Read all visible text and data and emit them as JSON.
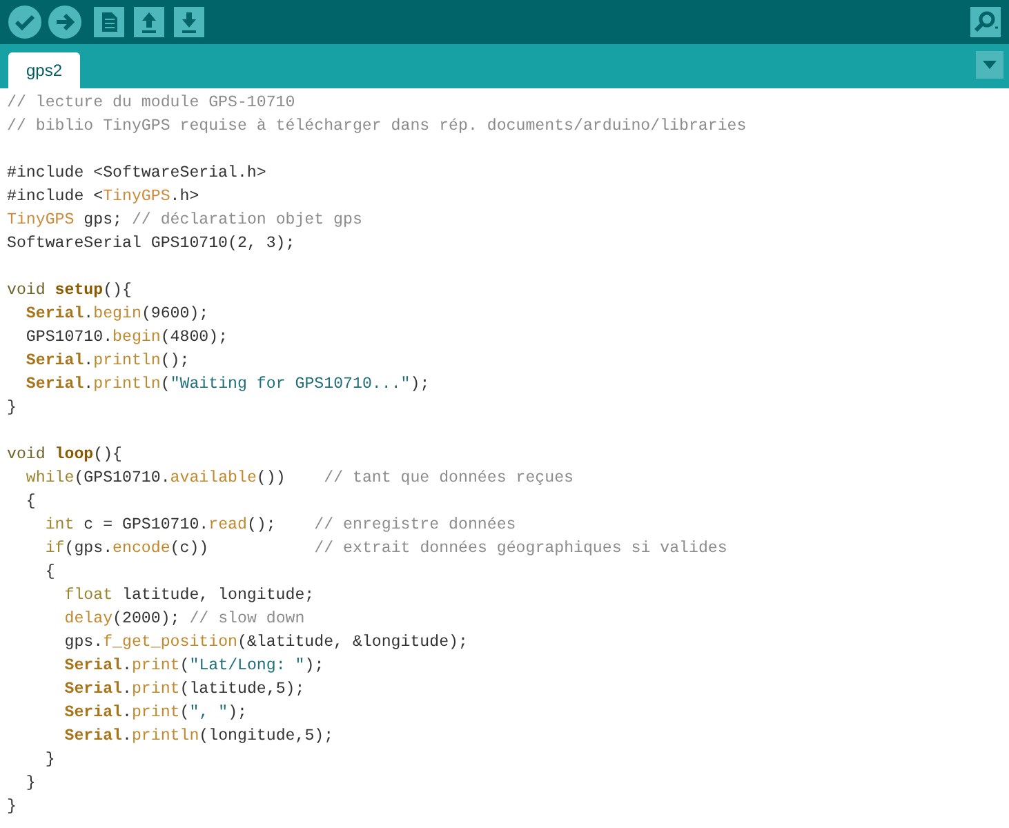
{
  "toolbar": {
    "buttons": [
      {
        "kind": "verify"
      },
      {
        "kind": "upload"
      },
      {
        "kind": "new"
      },
      {
        "kind": "open"
      },
      {
        "kind": "save"
      }
    ],
    "right_button": {
      "kind": "serial-monitor"
    }
  },
  "tabs": [
    {
      "label": "gps2",
      "selected": true
    }
  ],
  "code": {
    "lines": [
      {
        "tokens": [
          {
            "kind": "comment",
            "text": "// lecture du module GPS-10710"
          }
        ]
      },
      {
        "tokens": [
          {
            "kind": "comment",
            "text": "// biblio TinyGPS requise à télécharger dans rép. documents/arduino/libraries"
          }
        ]
      },
      {
        "space_before": true,
        "tokens": [
          {
            "kind": "plain",
            "text": "#include <SoftwareSerial.h>"
          }
        ]
      },
      {
        "tokens": [
          {
            "kind": "plain",
            "text": "#include <"
          },
          {
            "kind": "class",
            "text": "TinyGPS"
          },
          {
            "kind": "plain",
            "text": ".h>"
          }
        ]
      },
      {
        "tokens": [
          {
            "kind": "class",
            "text": "TinyGPS"
          },
          {
            "kind": "plain",
            "text": " gps; "
          },
          {
            "kind": "comment",
            "text": "// déclaration objet gps"
          }
        ]
      },
      {
        "tokens": [
          {
            "kind": "plain",
            "text": "SoftwareSerial GPS10710(2, 3);"
          }
        ]
      },
      {
        "space_before": true,
        "tokens": [
          {
            "kind": "type",
            "text": "void "
          },
          {
            "kind": "bold-keyword",
            "text": "setup"
          },
          {
            "kind": "plain",
            "text": "(){"
          }
        ]
      },
      {
        "tokens": [
          {
            "kind": "bold-class",
            "text": "  Serial"
          },
          {
            "kind": "plain",
            "text": "."
          },
          {
            "kind": "function",
            "text": "begin"
          },
          {
            "kind": "plain",
            "text": "(9600);"
          }
        ]
      },
      {
        "tokens": [
          {
            "kind": "plain",
            "text": "  GPS10710."
          },
          {
            "kind": "function",
            "text": "begin"
          },
          {
            "kind": "plain",
            "text": "(4800);"
          }
        ]
      },
      {
        "tokens": [
          {
            "kind": "bold-class",
            "text": "  Serial"
          },
          {
            "kind": "plain",
            "text": "."
          },
          {
            "kind": "function",
            "text": "println"
          },
          {
            "kind": "plain",
            "text": "();"
          }
        ]
      },
      {
        "tokens": [
          {
            "kind": "bold-class",
            "text": "  Serial"
          },
          {
            "kind": "plain",
            "text": "."
          },
          {
            "kind": "function",
            "text": "println"
          },
          {
            "kind": "plain",
            "text": "("
          },
          {
            "kind": "string",
            "text": "\"Waiting for GPS10710...\""
          },
          {
            "kind": "plain",
            "text": ");"
          }
        ]
      },
      {
        "tokens": [
          {
            "kind": "plain",
            "text": "}"
          }
        ]
      },
      {
        "space_before": true,
        "tokens": [
          {
            "kind": "type",
            "text": "void "
          },
          {
            "kind": "bold-keyword",
            "text": "loop"
          },
          {
            "kind": "plain",
            "text": "(){"
          }
        ]
      },
      {
        "tokens": [
          {
            "kind": "keyword",
            "text": "  while"
          },
          {
            "kind": "plain",
            "text": "(GPS10710."
          },
          {
            "kind": "function",
            "text": "available"
          },
          {
            "kind": "plain",
            "text": "())    "
          },
          {
            "kind": "comment",
            "text": "// tant que données reçues"
          }
        ]
      },
      {
        "tokens": [
          {
            "kind": "plain",
            "text": "  {"
          }
        ]
      },
      {
        "tokens": [
          {
            "kind": "keyword",
            "text": "    int"
          },
          {
            "kind": "plain",
            "text": " c = GPS10710."
          },
          {
            "kind": "function",
            "text": "read"
          },
          {
            "kind": "plain",
            "text": "();    "
          },
          {
            "kind": "comment",
            "text": "// enregistre données"
          }
        ]
      },
      {
        "tokens": [
          {
            "kind": "keyword",
            "text": "    if"
          },
          {
            "kind": "plain",
            "text": "(gps."
          },
          {
            "kind": "function",
            "text": "encode"
          },
          {
            "kind": "plain",
            "text": "(c))           "
          },
          {
            "kind": "comment",
            "text": "// extrait données géographiques si valides"
          }
        ]
      },
      {
        "tokens": [
          {
            "kind": "plain",
            "text": "    {"
          }
        ]
      },
      {
        "tokens": [
          {
            "kind": "keyword",
            "text": "      float"
          },
          {
            "kind": "plain",
            "text": " latitude, longitude;"
          }
        ]
      },
      {
        "tokens": [
          {
            "kind": "function",
            "text": "      delay"
          },
          {
            "kind": "plain",
            "text": "(2000); "
          },
          {
            "kind": "comment",
            "text": "// slow down"
          }
        ]
      },
      {
        "tokens": [
          {
            "kind": "plain",
            "text": "      gps."
          },
          {
            "kind": "function",
            "text": "f_get_position"
          },
          {
            "kind": "plain",
            "text": "(&latitude, &longitude);"
          }
        ]
      },
      {
        "tokens": [
          {
            "kind": "bold-class",
            "text": "      Serial"
          },
          {
            "kind": "plain",
            "text": "."
          },
          {
            "kind": "function",
            "text": "print"
          },
          {
            "kind": "plain",
            "text": "("
          },
          {
            "kind": "string",
            "text": "\"Lat/Long: \""
          },
          {
            "kind": "plain",
            "text": ");"
          }
        ]
      },
      {
        "tokens": [
          {
            "kind": "bold-class",
            "text": "      Serial"
          },
          {
            "kind": "plain",
            "text": "."
          },
          {
            "kind": "function",
            "text": "print"
          },
          {
            "kind": "plain",
            "text": "(latitude,5);"
          }
        ]
      },
      {
        "tokens": [
          {
            "kind": "bold-class",
            "text": "      Serial"
          },
          {
            "kind": "plain",
            "text": "."
          },
          {
            "kind": "function",
            "text": "print"
          },
          {
            "kind": "plain",
            "text": "("
          },
          {
            "kind": "string",
            "text": "\", \""
          },
          {
            "kind": "plain",
            "text": ");"
          }
        ]
      },
      {
        "tokens": [
          {
            "kind": "bold-class",
            "text": "      Serial"
          },
          {
            "kind": "plain",
            "text": "."
          },
          {
            "kind": "function",
            "text": "println"
          },
          {
            "kind": "plain",
            "text": "(longitude,5);"
          }
        ]
      },
      {
        "tokens": [
          {
            "kind": "plain",
            "text": "    }"
          }
        ]
      },
      {
        "tokens": [
          {
            "kind": "plain",
            "text": "  }"
          }
        ]
      },
      {
        "tokens": [
          {
            "kind": "plain",
            "text": "}"
          }
        ]
      }
    ]
  }
}
